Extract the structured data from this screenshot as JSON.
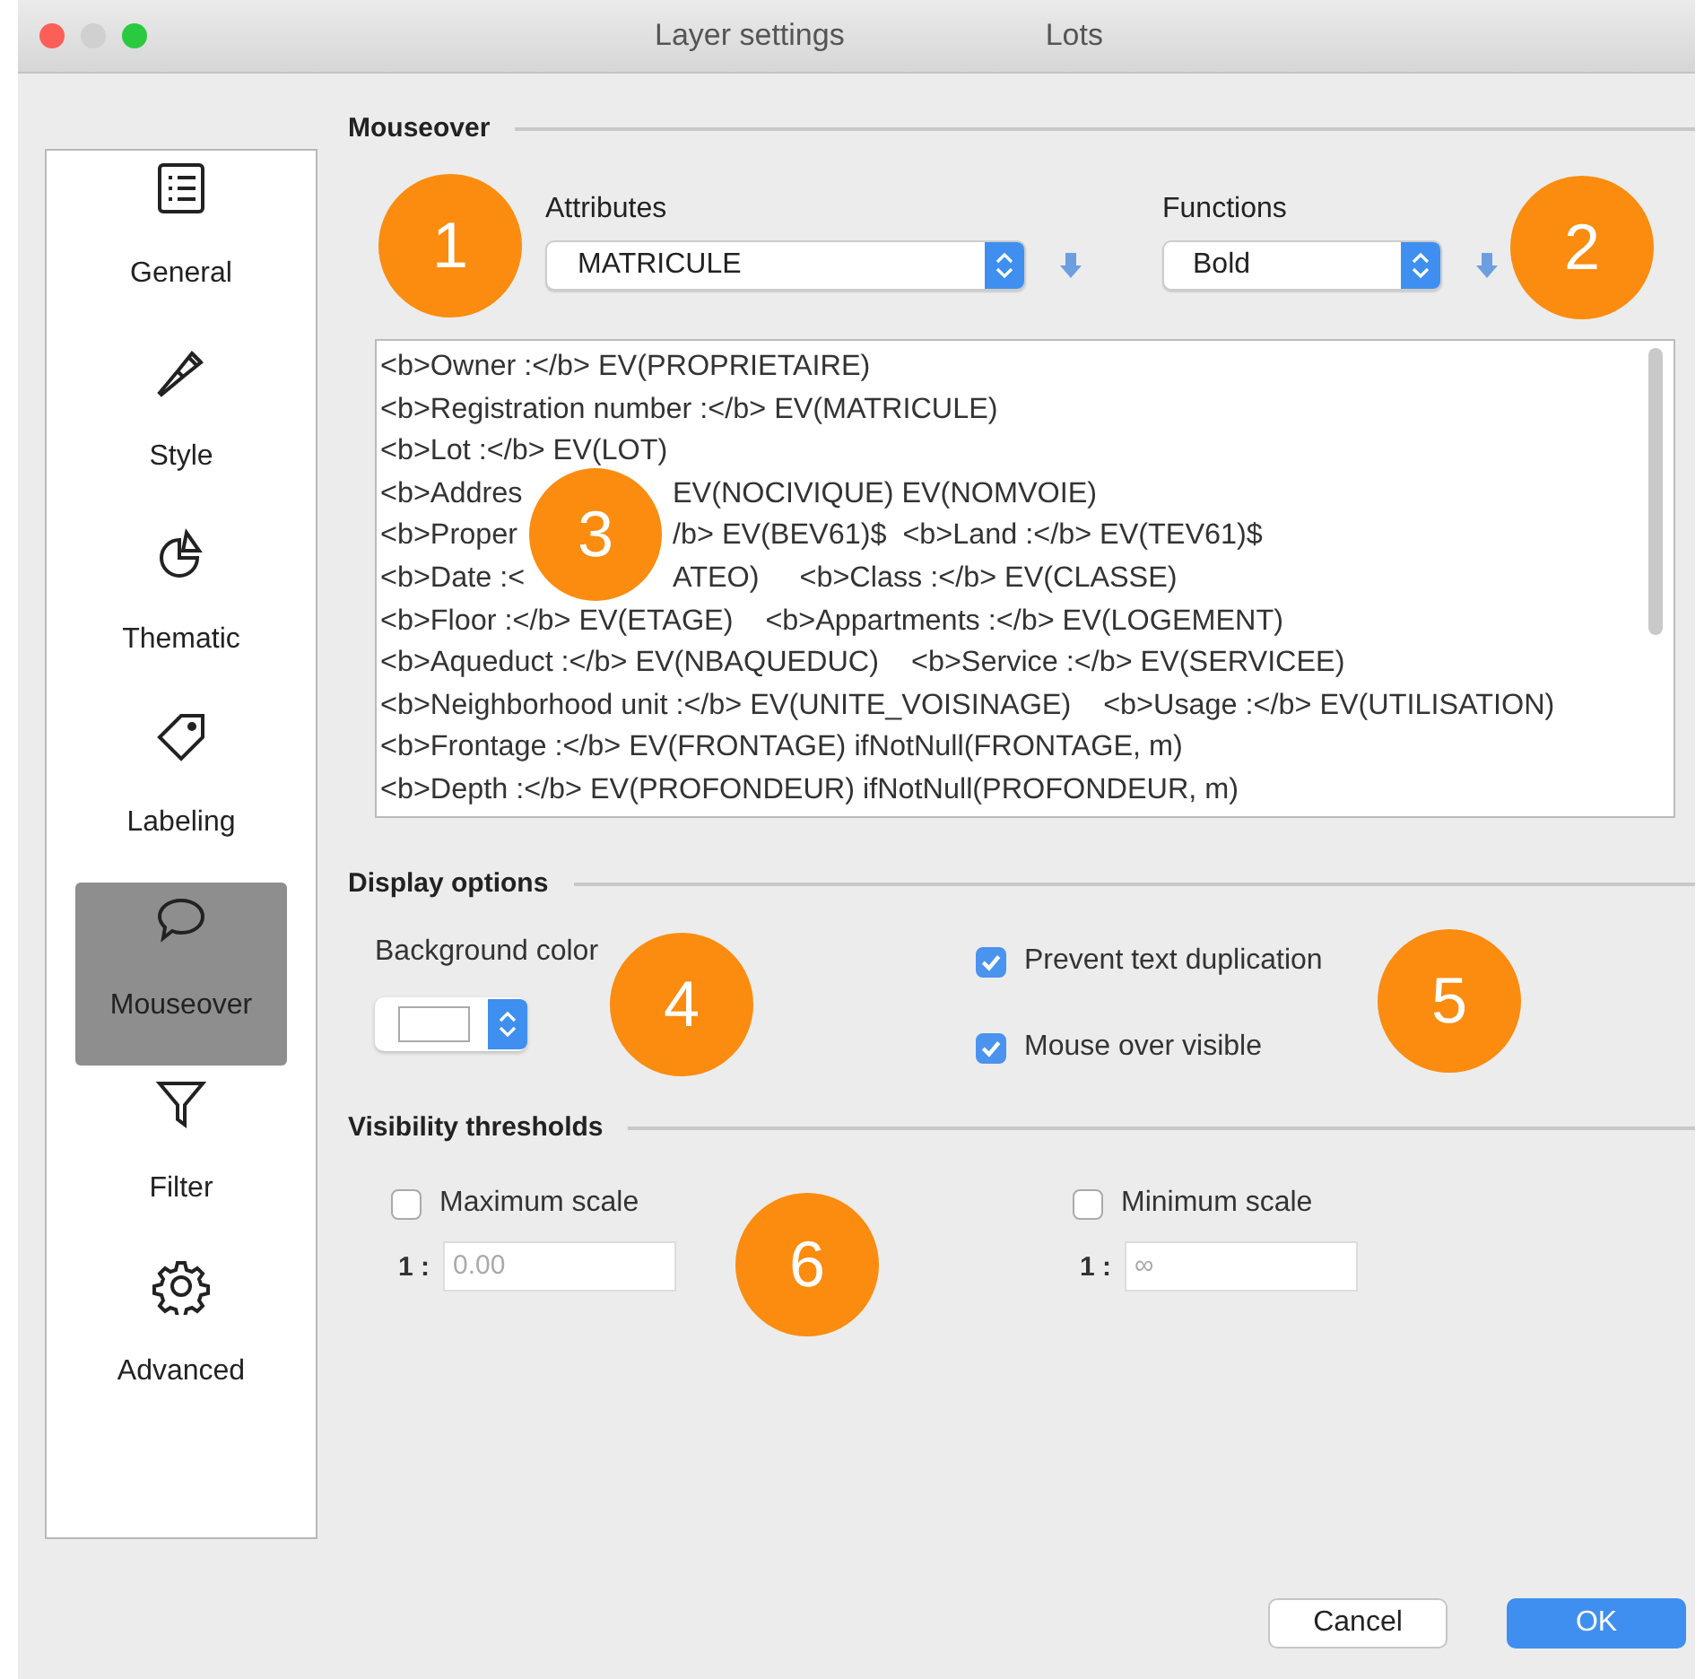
{
  "window": {
    "title": "Layer settings",
    "subtitle": "Lots"
  },
  "sidebar": {
    "items": [
      {
        "label": "General",
        "kind": "list",
        "selected": false
      },
      {
        "label": "Style",
        "kind": "brush",
        "selected": false
      },
      {
        "label": "Thematic",
        "kind": "pie",
        "selected": false
      },
      {
        "label": "Labeling",
        "kind": "tag",
        "selected": false
      },
      {
        "label": "Mouseover",
        "kind": "bubble",
        "selected": true
      },
      {
        "label": "Filter",
        "kind": "funnel",
        "selected": false
      },
      {
        "label": "Advanced",
        "kind": "gear",
        "selected": false
      }
    ]
  },
  "mouseover": {
    "heading": "Mouseover",
    "attributes": {
      "label": "Attributes",
      "value": "MATRICULE"
    },
    "functions": {
      "label": "Functions",
      "value": "Bold"
    },
    "lines": [
      {
        "segments": [
          "<b>Owner :</b> EV(PROPRIETAIRE)"
        ]
      },
      {
        "segments": [
          "<b>Registration number :</b> EV(MATRICULE)"
        ]
      },
      {
        "segments": [
          "<b>Lot :</b> EV(LOT)"
        ]
      },
      {
        "segments": [
          "<b>Addres",
          "EV(NOCIVIQUE) EV(NOMVOIE)"
        ]
      },
      {
        "segments": [
          "<b>Proper",
          "/b> EV(BEV61)$  <b>Land :</b> EV(TEV61)$"
        ]
      },
      {
        "segments": [
          "<b>Date :<",
          "ATEO)     <b>Class :</b> EV(CLASSE)"
        ]
      },
      {
        "segments": [
          "<b>Floor :</b> EV(ETAGE)    <b>Appartments :</b> EV(LOGEMENT)"
        ]
      },
      {
        "segments": [
          "<b>Aqueduct :</b> EV(NBAQUEDUC)    <b>Service :</b> EV(SERVICEE)"
        ]
      },
      {
        "segments": [
          "<b>Neighborhood unit :</b> EV(UNITE_VOISINAGE)    <b>Usage :</b> EV(UTILISATION)"
        ]
      },
      {
        "segments": [
          "<b>Frontage :</b> EV(FRONTAGE) ifNotNull(FRONTAGE, m)"
        ]
      },
      {
        "segments": [
          "<b>Depth :</b> EV(PROFONDEUR) ifNotNull(PROFONDEUR, m)"
        ]
      }
    ]
  },
  "display_options": {
    "heading": "Display options",
    "background_color": {
      "label": "Background color"
    },
    "checkboxes": [
      {
        "label": "Prevent text duplication",
        "checked": true
      },
      {
        "label": "Mouse over visible",
        "checked": true
      }
    ]
  },
  "visibility_thresholds": {
    "heading": "Visibility thresholds",
    "scales": [
      {
        "label": "Maximum scale",
        "checked": false,
        "prefix": "1 :",
        "value": "0.00"
      },
      {
        "label": "Minimum scale",
        "checked": false,
        "prefix": "1 :",
        "value": "∞"
      }
    ]
  },
  "buttons": [
    {
      "label": "Cancel",
      "kind": "default"
    },
    {
      "label": "OK",
      "kind": "primary"
    }
  ],
  "badges": [
    {
      "label": "1"
    },
    {
      "label": "2"
    },
    {
      "label": "3"
    },
    {
      "label": "4"
    },
    {
      "label": "5"
    },
    {
      "label": "6"
    }
  ]
}
